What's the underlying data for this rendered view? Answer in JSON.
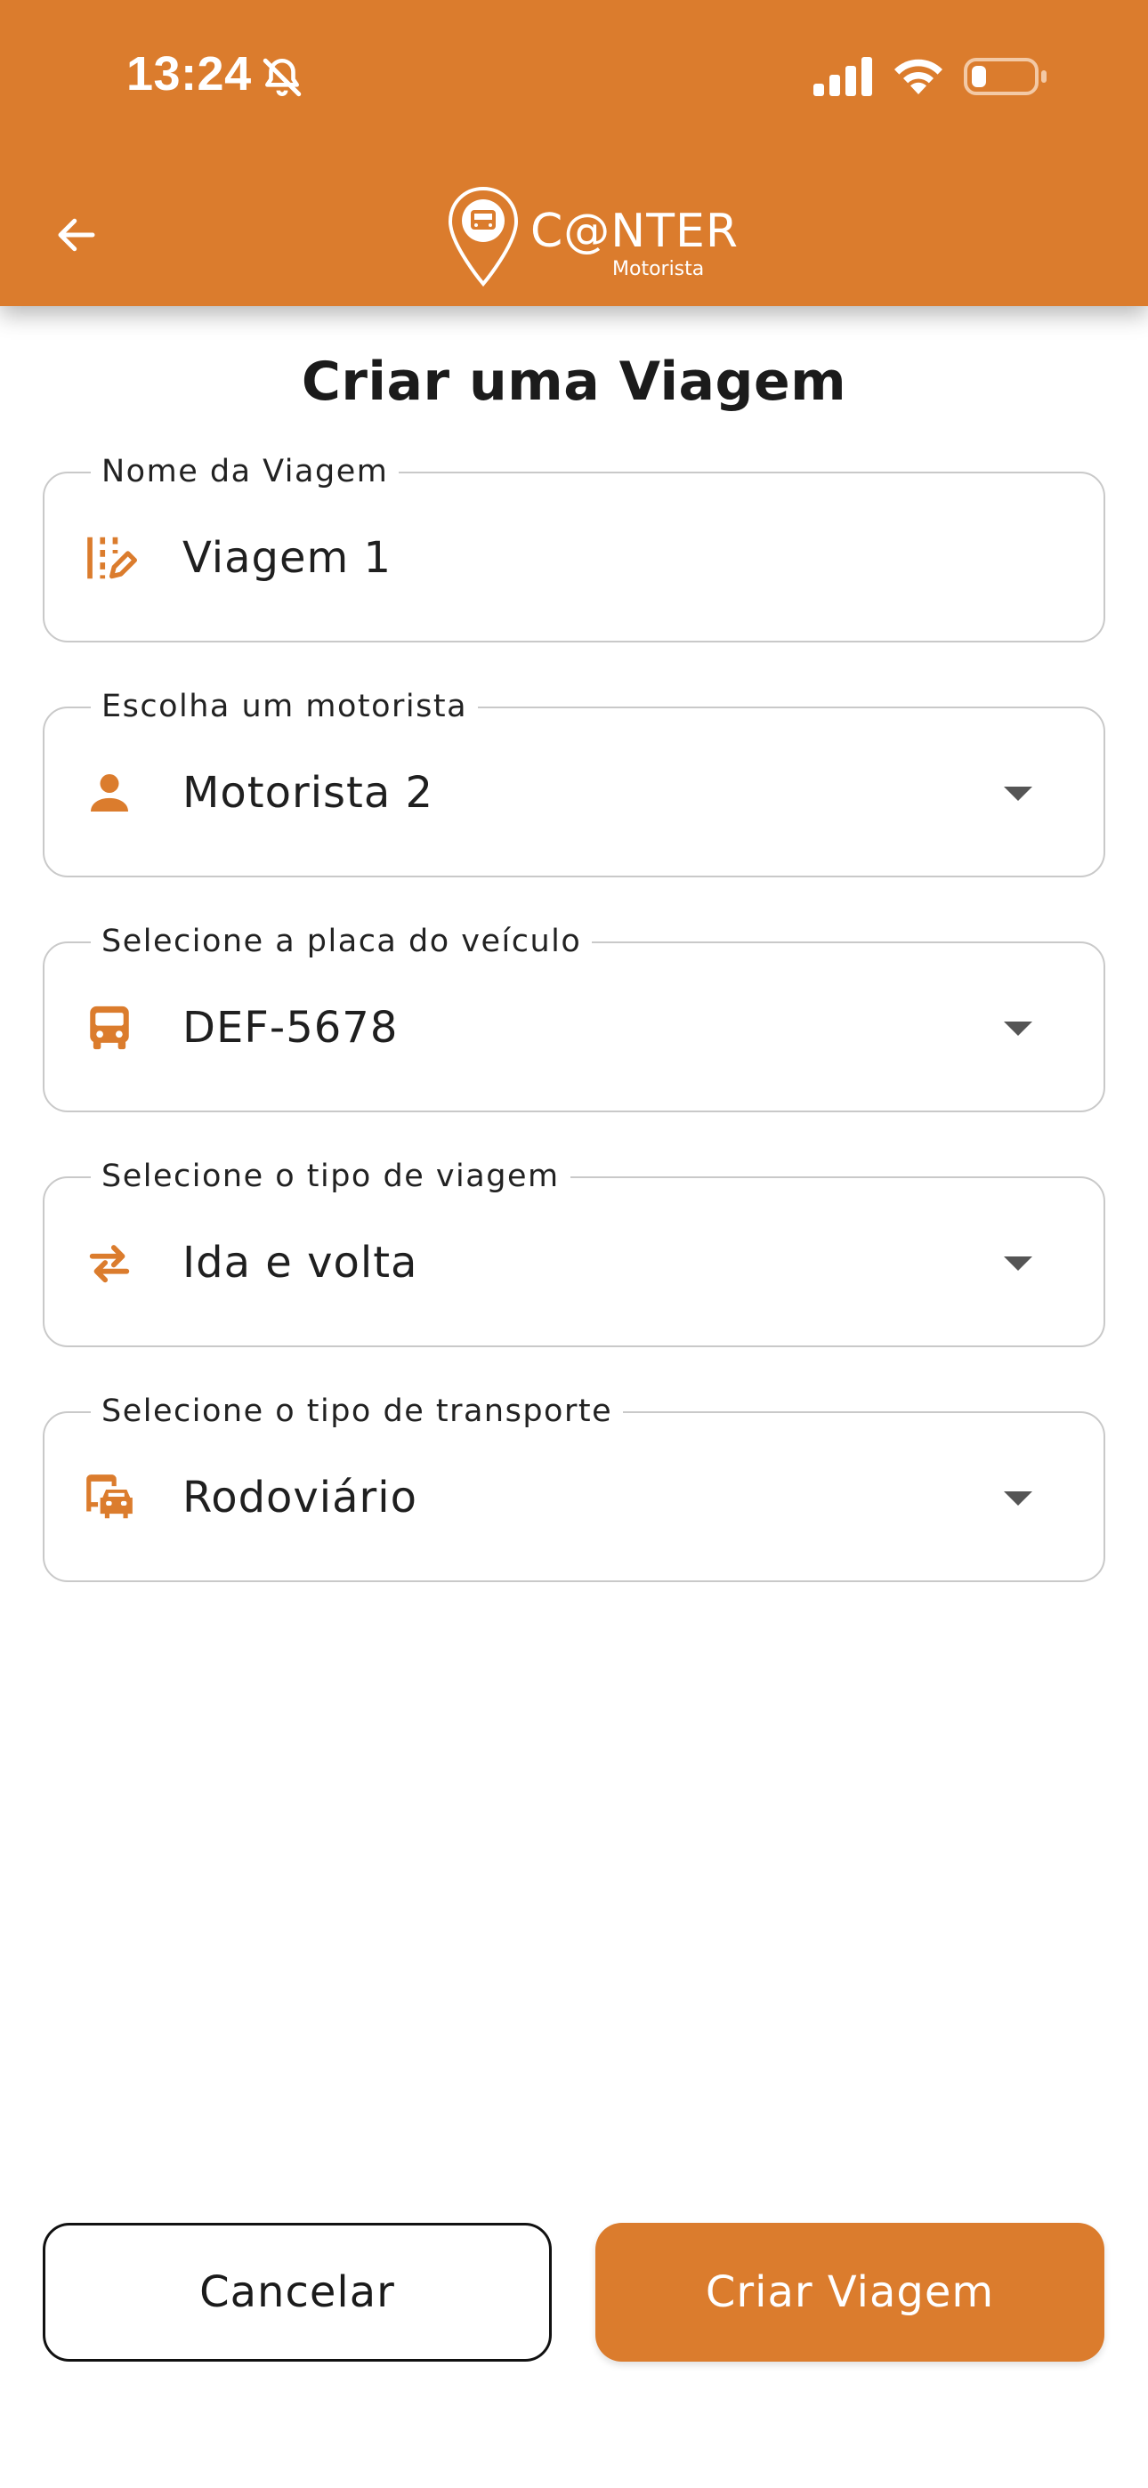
{
  "status_bar": {
    "time": "13:24",
    "icons": [
      "bell-slash-icon",
      "cellular-signal-icon",
      "wifi-icon",
      "battery-icon"
    ]
  },
  "header": {
    "back_icon": "arrow-left-icon",
    "logo": {
      "name": "C@NTER",
      "subtitle": "Motorista"
    },
    "background_color": "#db7c2d"
  },
  "page": {
    "title": "Criar uma Viagem"
  },
  "fields": [
    {
      "label": "Nome da Viagem",
      "value": "Viagem 1",
      "icon": "edit-note-icon",
      "dropdown": false
    },
    {
      "label": "Escolha um motorista",
      "value": "Motorista 2",
      "icon": "person-icon",
      "dropdown": true
    },
    {
      "label": "Selecione a placa do veículo",
      "value": "DEF-5678",
      "icon": "bus-icon",
      "dropdown": true
    },
    {
      "label": "Selecione o tipo de viagem",
      "value": "Ida e volta",
      "icon": "swap-arrows-icon",
      "dropdown": true
    },
    {
      "label": "Selecione o tipo de transporte",
      "value": "Rodoviário",
      "icon": "bus-car-icon",
      "dropdown": true
    }
  ],
  "actions": {
    "cancel_label": "Cancelar",
    "create_label": "Criar Viagem"
  },
  "colors": {
    "accent": "#db7c2d",
    "border": "#c9c9c9",
    "text": "#1f1f1f"
  }
}
